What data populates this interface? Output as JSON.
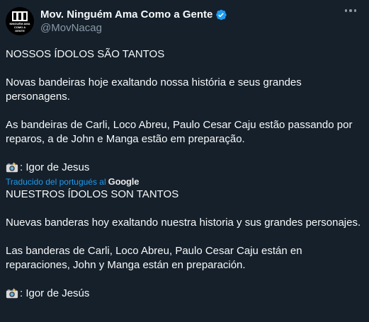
{
  "author": {
    "display_name": "Mov. Ninguém Ama Como a Gente",
    "handle": "@MovNacag",
    "avatar_text": "NINGUÉM AMA COMO A GENTE"
  },
  "original": {
    "heading": "NOSSOS ÍDOLOS SÃO TANTOS",
    "paragraph1": "Novas bandeiras hoje exaltando nossa história e seus grandes personagens.",
    "paragraph2": "As bandeiras de Carli, Loco Abreu, Paulo Cesar Caju estão passando por reparos, a de John e Manga estão em preparação.",
    "credit": ": Igor de Jesus"
  },
  "translation": {
    "label": "Traducido del portugués al",
    "provider": "Google",
    "heading": "NUESTROS ÍDOLOS SON TANTOS",
    "paragraph1": "Nuevas banderas hoy exaltando nuestra historia y sus grandes personajes.",
    "paragraph2": "Las banderas de Carli, Loco Abreu, Paulo Cesar Caju están en reparaciones, John y Manga están en preparación.",
    "credit": " : Igor de Jesús"
  },
  "icons": {
    "verified": "verified-badge-icon",
    "more": "more-options-icon",
    "camera": "camera-emoji-icon"
  },
  "colors": {
    "background": "#15202b",
    "text": "#f7f9f9",
    "secondary": "#8b98a5",
    "accent": "#1d9bf0"
  }
}
